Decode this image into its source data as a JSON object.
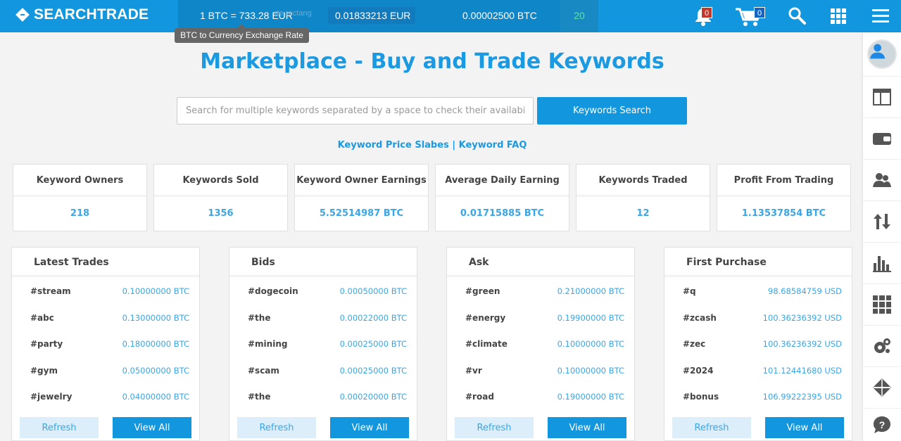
{
  "brand": {
    "name": "SEARCHTRADE"
  },
  "rates": {
    "btc_eur": "1 BTC = 733.28 EUR",
    "value2": "0.01833213 EUR",
    "value3": "0.00002500 BTC",
    "count": "20",
    "ghost_text": "rte rectang",
    "tooltip": "BTC to Currency Exchange Rate"
  },
  "header_icons": {
    "notifications_count": "0",
    "cart_count": "0"
  },
  "page": {
    "title": "Marketplace - Buy and Trade Keywords",
    "search_placeholder": "Search for multiple keywords separated by a space to check their availability",
    "search_button": "Keywords Search",
    "link_price": "Keyword Price Slabes",
    "link_sep": "|",
    "link_faq": "Keyword FAQ"
  },
  "stats": [
    {
      "label": "Keyword Owners",
      "value": "218"
    },
    {
      "label": "Keywords Sold",
      "value": "1356"
    },
    {
      "label": "Keyword Owner Earnings",
      "value": "5.52514987 BTC"
    },
    {
      "label": "Average Daily Earning",
      "value": "0.01715885 BTC"
    },
    {
      "label": "Keywords Traded",
      "value": "12"
    },
    {
      "label": "Profit From Trading",
      "value": "1.13537854 BTC"
    }
  ],
  "panels": [
    {
      "title": "Latest Trades",
      "refresh": "Refresh",
      "view_all": "View All",
      "rows": [
        {
          "kw": "#stream",
          "val": "0.10000000 BTC"
        },
        {
          "kw": "#abc",
          "val": "0.13000000 BTC"
        },
        {
          "kw": "#party",
          "val": "0.18000000 BTC"
        },
        {
          "kw": "#gym",
          "val": "0.05000000 BTC"
        },
        {
          "kw": "#jewelry",
          "val": "0.04000000 BTC"
        }
      ]
    },
    {
      "title": "Bids",
      "refresh": "Refresh",
      "view_all": "View All",
      "rows": [
        {
          "kw": "#dogecoin",
          "val": "0.00050000 BTC"
        },
        {
          "kw": "#the",
          "val": "0.00022000 BTC"
        },
        {
          "kw": "#mining",
          "val": "0.00025000 BTC"
        },
        {
          "kw": "#scam",
          "val": "0.00025000 BTC"
        },
        {
          "kw": "#the",
          "val": "0.00020000 BTC"
        }
      ]
    },
    {
      "title": "Ask",
      "refresh": "Refresh",
      "view_all": "View All",
      "rows": [
        {
          "kw": "#green",
          "val": "0.21000000 BTC"
        },
        {
          "kw": "#energy",
          "val": "0.19900000 BTC"
        },
        {
          "kw": "#climate",
          "val": "0.10000000 BTC"
        },
        {
          "kw": "#vr",
          "val": "0.10000000 BTC"
        },
        {
          "kw": "#road",
          "val": "0.19000000 BTC"
        }
      ]
    },
    {
      "title": "First Purchase",
      "refresh": "Refresh",
      "view_all": "View All",
      "rows": [
        {
          "kw": "#q",
          "val": "98.68584759 USD"
        },
        {
          "kw": "#zcash",
          "val": "100.36236392 USD"
        },
        {
          "kw": "#zec",
          "val": "100.36236392 USD"
        },
        {
          "kw": "#2024",
          "val": "101.12441680 USD"
        },
        {
          "kw": "#bonus",
          "val": "106.99222395 USD"
        }
      ]
    }
  ],
  "sidebar_icons": [
    "user-avatar-icon",
    "dashboard-icon",
    "wallet-icon",
    "users-icon",
    "transfer-icon",
    "bar-chart-icon",
    "grid-icon",
    "settings-icon",
    "diamond-icon",
    "help-icon"
  ],
  "colors": {
    "brand_blue": "#1297df",
    "accent_text": "#3aa6e5",
    "count_green": "#5fe0a7"
  }
}
